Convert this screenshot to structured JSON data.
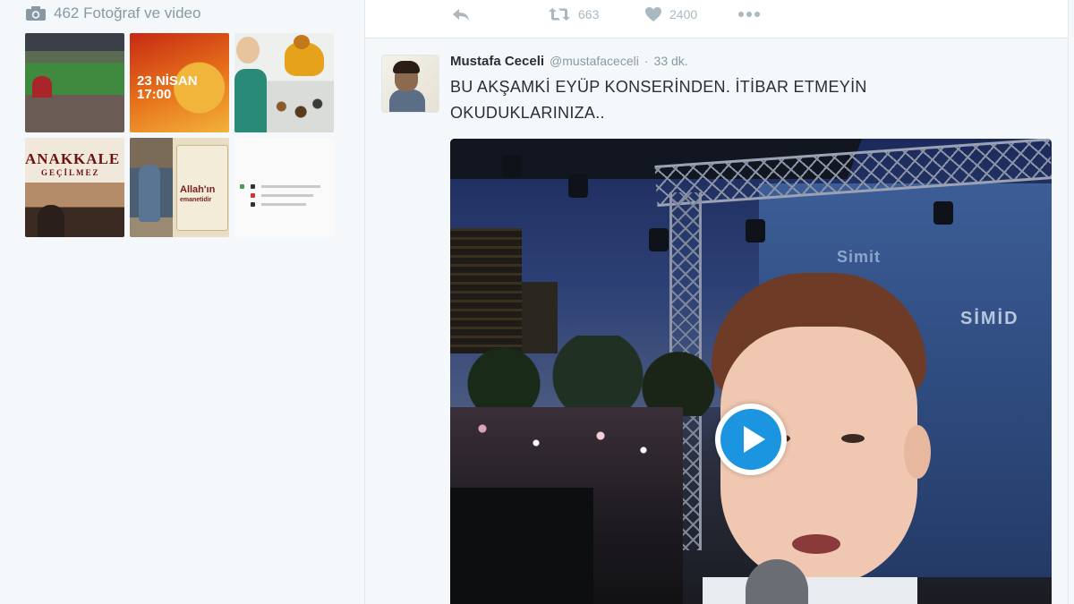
{
  "media_sidebar": {
    "header_text": "462 Fotoğraf ve video",
    "thumbnails": [
      {
        "kind": "stadium-photo"
      },
      {
        "kind": "poster",
        "line1": "",
        "line2": "23 NİSAN\n17:00",
        "line3": ""
      },
      {
        "kind": "child-toy-photo"
      },
      {
        "kind": "book-cover",
        "line1": "ANAKKALE",
        "line2": "GEÇİLMEZ"
      },
      {
        "kind": "poster",
        "line4": "Allah'ın",
        "line5": "emanetidir"
      },
      {
        "kind": "document"
      }
    ]
  },
  "top_tweet_actions": {
    "retweet_count": "663",
    "like_count": "2400"
  },
  "tweet": {
    "fullname": "Mustafa Ceceli",
    "username": "@mustafaceceli",
    "separator": "·",
    "timestamp": "33 dk.",
    "text": "BU AKŞAMKİ EYÜP KONSERİNDEN. İTİBAR ETMEYİN OKUDUKLARINIZA..",
    "video": {
      "screen_text_1": "Simit",
      "screen_text_2": "SİMİD"
    }
  },
  "colors": {
    "page_background": "#f5f8fa",
    "muted": "#8899a6",
    "icon_muted": "#aab8c2",
    "play_button": "#1b95e0"
  },
  "icons": [
    "camera-icon",
    "reply-icon",
    "retweet-icon",
    "heart-icon",
    "more-icon",
    "play-icon"
  ]
}
